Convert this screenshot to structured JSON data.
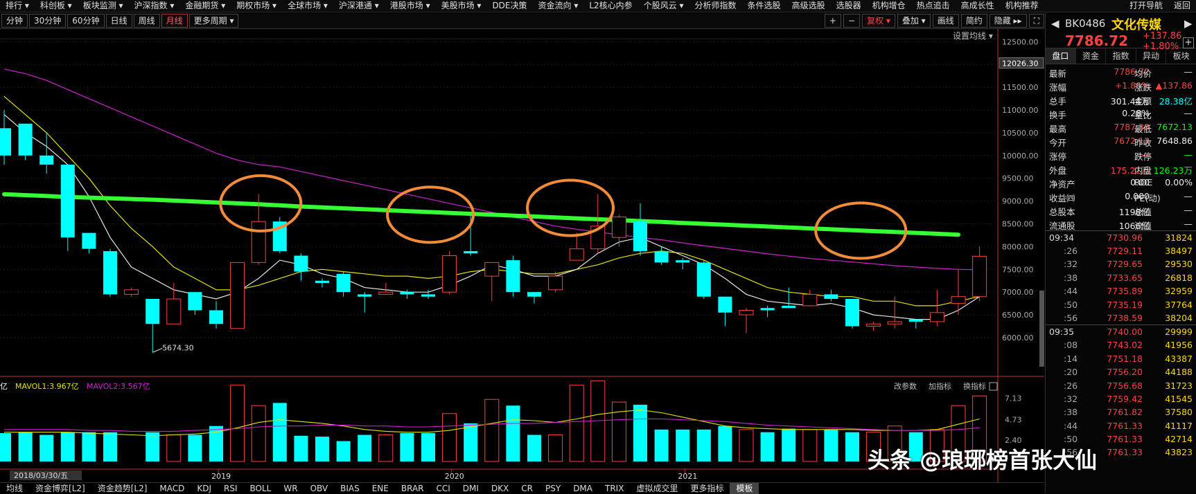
{
  "menubar": {
    "items": [
      "排行 ▾",
      "科创板 ▾",
      "板块监测 ▾",
      "沪深指数 ▾",
      "金融期货 ▾",
      "期权市场 ▾",
      "全球市场 ▾",
      "沪深港通 ▾",
      "港股市场 ▾",
      "美股市场 ▾",
      "DDE决策",
      "资金流向 ▾",
      "L2核心内参",
      "个股风云 ▾",
      "分析师指数",
      "条件选股",
      "高级选股",
      "选股器",
      "机构增仓",
      "热点追击",
      "高成长性",
      "机构推荐"
    ],
    "right": [
      "打开导航",
      "返回"
    ]
  },
  "toolbar": {
    "periods": [
      "分钟",
      "30分钟",
      "60分钟",
      "日线",
      "周线",
      "月线",
      "更多周期 ▾"
    ],
    "active": "月线",
    "right": [
      "+",
      "−",
      "复权 ▾",
      "叠加 ▾",
      "画线",
      "简约",
      "隐藏 ▸▸",
      "⛶"
    ]
  },
  "setting_label": "设置均线 ▾",
  "bottom_tabs": [
    "均线",
    "资金博弈[L2]",
    "资金趋势[L2]",
    "MACD",
    "KDJ",
    "RSI",
    "BOLL",
    "WR",
    "OBV",
    "BIAS",
    "ENE",
    "BRAR",
    "CCI",
    "DMI",
    "DKX",
    "CR",
    "PSY",
    "DMA",
    "TRIX",
    "虚拟成交里",
    "更多指标",
    "模板"
  ],
  "active_bottom": "模板",
  "volume_header": {
    "mavol1": "MAVOL1:3.967亿",
    "mavol2": "MAVOL2:3.567亿",
    "prefix": "亿"
  },
  "volume_tools": [
    "改参数",
    "加指标",
    "换指标"
  ],
  "date_label": "2018/03/30/五",
  "watermark": "头条 @琅琊榜首张大仙",
  "colors": {
    "up": "#ff4040",
    "down": "#00ffff",
    "ma_white": "#e8e8e8",
    "ma_yellow": "#e5e500",
    "ma_magenta": "#d020d0",
    "ma_green": "#33ff33",
    "circle": "#f08c3a"
  },
  "chart_data": {
    "type": "candlestick",
    "price_axis": [
      6000,
      6500,
      7000,
      7500,
      8000,
      8500,
      9000,
      9500,
      10000,
      10500,
      11000,
      11500,
      12000,
      12500
    ],
    "price_axis_labels": [
      "6000.00",
      "6500.00",
      "7000.00",
      "7500.00",
      "8000.00",
      "8500.00",
      "9000.00",
      "9500.00",
      "10000.00",
      "10500.00",
      "11000.00",
      "11500.00",
      "12000.00",
      "12500.00"
    ],
    "price_cursor": "12026.30",
    "low_label": "5674.30",
    "volume_axis": [
      "2.40",
      "4.73",
      "7.13"
    ],
    "x_labels": [
      "2019",
      "2020",
      "2021"
    ],
    "candles": [
      [
        10600,
        10000,
        11000,
        9800,
        3.2
      ],
      [
        10700,
        10000,
        10700,
        9900,
        3.3
      ],
      [
        10000,
        9800,
        10500,
        9600,
        3.0
      ],
      [
        9800,
        8200,
        9800,
        7900,
        3.3
      ],
      [
        8300,
        7950,
        8300,
        7850,
        3.3
      ],
      [
        7900,
        6950,
        7950,
        6900,
        3.3
      ],
      [
        6950,
        7050,
        7100,
        6900,
        0
      ],
      [
        6850,
        6300,
        6850,
        5674.3,
        3.3
      ],
      [
        6300,
        6850,
        7200,
        6300,
        3.0
      ],
      [
        7000,
        6600,
        7000,
        6500,
        3.0
      ],
      [
        6600,
        6300,
        6800,
        6200,
        4.0
      ],
      [
        6200,
        7650,
        7650,
        6200,
        8.6
      ],
      [
        7650,
        8550,
        9150,
        7600,
        6.3
      ],
      [
        8550,
        7900,
        8650,
        7850,
        6.6
      ],
      [
        7800,
        7450,
        7850,
        7250,
        2.9
      ],
      [
        7250,
        7200,
        7300,
        7100,
        2.8
      ],
      [
        7400,
        7000,
        7450,
        6900,
        2.3
      ],
      [
        6950,
        6900,
        7000,
        6550,
        3.0
      ],
      [
        6950,
        7000,
        7200,
        6950,
        3.0
      ],
      [
        7000,
        6950,
        7050,
        6850,
        3.2
      ],
      [
        6950,
        6900,
        7050,
        6850,
        3.2
      ],
      [
        7000,
        7800,
        7900,
        6950,
        5.4
      ],
      [
        7900,
        7850,
        8700,
        7800,
        4.3
      ],
      [
        7350,
        7650,
        7500,
        6800,
        7.0
      ],
      [
        7700,
        7000,
        7800,
        6900,
        6.3
      ],
      [
        7000,
        6900,
        7000,
        6750,
        3.0
      ],
      [
        7050,
        7350,
        7450,
        7000,
        3.0
      ],
      [
        7700,
        7950,
        8300,
        7700,
        8.6
      ],
      [
        7950,
        8450,
        9150,
        7850,
        9.1
      ],
      [
        8200,
        8650,
        8700,
        8000,
        6.7
      ],
      [
        8550,
        7900,
        8950,
        7800,
        6.4
      ],
      [
        7900,
        7650,
        8000,
        7600,
        3.6
      ],
      [
        7700,
        7650,
        7750,
        7500,
        3.6
      ],
      [
        7650,
        6900,
        7700,
        6850,
        3.6
      ],
      [
        6900,
        6550,
        6900,
        6250,
        4.0
      ],
      [
        6500,
        6600,
        6650,
        6100,
        3.6
      ],
      [
        6650,
        6600,
        6700,
        6450,
        3.3
      ],
      [
        6700,
        6650,
        7100,
        6650,
        3.7
      ],
      [
        6700,
        6950,
        7050,
        6700,
        3.6
      ],
      [
        6950,
        6850,
        7050,
        6800,
        3.6
      ],
      [
        6850,
        6250,
        6850,
        6200,
        3.3
      ],
      [
        6250,
        6300,
        6350,
        6150,
        3.3
      ],
      [
        6300,
        6350,
        6900,
        6200,
        4.0
      ],
      [
        6400,
        6350,
        6400,
        6200,
        3.3
      ],
      [
        6350,
        6550,
        7050,
        6250,
        3.6
      ],
      [
        6750,
        6900,
        7500,
        6500,
        6.3
      ],
      [
        6900,
        7787,
        8000,
        6800,
        7.4
      ]
    ],
    "ma_green": [
      9150,
      9130,
      9110,
      9090,
      9075,
      9060,
      9045,
      9030,
      9010,
      8990,
      8970,
      8950,
      8930,
      8905,
      8880,
      8860,
      8840,
      8820,
      8800,
      8780,
      8760,
      8740,
      8720,
      8700,
      8680,
      8660,
      8640,
      8620,
      8600,
      8580,
      8560,
      8540,
      8520,
      8500,
      8480,
      8460,
      8440,
      8420,
      8400,
      8380,
      8360,
      8340,
      8320,
      8300,
      8280,
      8260,
      8240
    ],
    "ma_magenta": [
      11900,
      11800,
      11650,
      11450,
      11250,
      11050,
      10850,
      10650,
      10450,
      10250,
      10050,
      9900,
      9800,
      9750,
      9650,
      9550,
      9450,
      9350,
      9250,
      9150,
      9050,
      8950,
      8850,
      8750,
      8650,
      8550,
      8450,
      8380,
      8320,
      8260,
      8200,
      8150,
      8080,
      8020,
      7960,
      7900,
      7840,
      7790,
      7740,
      7700,
      7660,
      7620,
      7580,
      7550,
      7520,
      7500,
      7490
    ],
    "ma_yellow": [
      11300,
      10900,
      10500,
      10000,
      9500,
      8900,
      8400,
      8000,
      7550,
      7300,
      7050,
      7050,
      7150,
      7300,
      7450,
      7500,
      7450,
      7400,
      7350,
      7350,
      7300,
      7350,
      7450,
      7500,
      7450,
      7400,
      7400,
      7500,
      7600,
      7750,
      7850,
      7900,
      7850,
      7700,
      7500,
      7300,
      7100,
      7000,
      6950,
      6900,
      6900,
      6800,
      6800,
      6700,
      6700,
      6800,
      6900
    ],
    "ma_white": [
      10900,
      10500,
      10200,
      9800,
      9100,
      8200,
      7550,
      7300,
      7050,
      6950,
      6850,
      7000,
      7300,
      7700,
      7600,
      7400,
      7300,
      7100,
      7050,
      7000,
      7000,
      7150,
      7350,
      7600,
      7500,
      7350,
      7350,
      7500,
      7850,
      8100,
      8200,
      8000,
      7800,
      7600,
      7300,
      6950,
      6800,
      6750,
      6700,
      6750,
      6650,
      6500,
      6450,
      6400,
      6400,
      6600,
      6900
    ],
    "vol_ma_yellow": [
      3.3,
      3.3,
      3.3,
      3.3,
      3.2,
      3.1,
      3.0,
      2.9,
      3.0,
      3.1,
      3.3,
      3.8,
      4.4,
      4.7,
      4.5,
      4.3,
      4.0,
      3.6,
      3.4,
      3.3,
      3.3,
      3.5,
      3.9,
      4.3,
      4.7,
      4.6,
      4.4,
      4.8,
      5.3,
      5.6,
      5.8,
      5.5,
      5.0,
      4.5,
      4.0,
      3.8,
      3.7,
      3.6,
      3.6,
      3.6,
      3.6,
      3.5,
      3.5,
      3.5,
      3.6,
      4.2,
      4.8
    ],
    "vol_ma_magenta": [
      3.6,
      3.6,
      3.6,
      3.6,
      3.5,
      3.5,
      3.4,
      3.4,
      3.4,
      3.5,
      3.6,
      3.7,
      3.9,
      4.0,
      4.0,
      4.1,
      4.1,
      4.0,
      4.0,
      3.9,
      3.9,
      4.0,
      4.1,
      4.2,
      4.3,
      4.3,
      4.4,
      4.5,
      4.6,
      4.7,
      4.8,
      4.8,
      4.7,
      4.6,
      4.5,
      4.3,
      4.1,
      4.0,
      3.9,
      3.8,
      3.7,
      3.6,
      3.5,
      3.5,
      3.5,
      3.6,
      3.8
    ]
  },
  "quote": {
    "code": "BK0486",
    "name": "文化传媒",
    "price": "7786.72",
    "change": "+137.86",
    "pct": "+1.80%",
    "tabs": [
      "盘口",
      "资金",
      "指数",
      "异动",
      "板块"
    ],
    "active_tab": "盘口",
    "rows": [
      [
        "最新",
        "7786.72",
        "均价",
        "—"
      ],
      [
        "涨幅",
        "+1.80%",
        "涨跌",
        "▲137.86"
      ],
      [
        "总手",
        "301.44万",
        "金额",
        "28.38亿"
      ],
      [
        "换手",
        "0.28%",
        "量比",
        "—"
      ],
      [
        "最高",
        "7787.38",
        "最低",
        "7672.13"
      ],
      [
        "今开",
        "7672.13",
        "昨收",
        "7648.86"
      ],
      [
        "涨停",
        "—",
        "跌停",
        "—"
      ],
      [
        "外盘",
        "175.21万",
        "内盘",
        "126.23万"
      ],
      [
        "净资产",
        "0.00",
        "ROE",
        "0.00%"
      ],
      [
        "收益㈣",
        "0.000",
        "PE(动)",
        "—"
      ],
      [
        "总股本",
        "1198亿",
        "总值",
        "—"
      ],
      [
        "流通股",
        "1066亿",
        "流值",
        "—"
      ]
    ],
    "row_colors": [
      [
        "#ddd",
        "#ff4040",
        "#ddd",
        "#ddd"
      ],
      [
        "#ddd",
        "#ff4040",
        "#ddd",
        "#ff4040"
      ],
      [
        "#ddd",
        "#eee",
        "#ddd",
        "#00ffff"
      ],
      [
        "#ddd",
        "#eee",
        "#ddd",
        "#ddd"
      ],
      [
        "#ddd",
        "#ff4040",
        "#ddd",
        "#00ff00"
      ],
      [
        "#ddd",
        "#ff4040",
        "#ddd",
        "#eee"
      ],
      [
        "#ddd",
        "#ff4040",
        "#ddd",
        "#00ff00"
      ],
      [
        "#ddd",
        "#ff4040",
        "#ddd",
        "#00ff00"
      ],
      [
        "#ddd",
        "#eee",
        "#ddd",
        "#eee"
      ],
      [
        "#ddd",
        "#eee",
        "#ddd",
        "#ddd"
      ],
      [
        "#ddd",
        "#eee",
        "#ddd",
        "#ddd"
      ],
      [
        "#ddd",
        "#eee",
        "#ddd",
        "#ddd"
      ]
    ],
    "ticks_a": {
      "head": [
        "09:34",
        "7730.96",
        "31824"
      ],
      "rows": [
        [
          ":26",
          "7729.11",
          "38497"
        ],
        [
          ":32",
          "7729.65",
          "29530"
        ],
        [
          ":38",
          "7733.65",
          "26818"
        ],
        [
          ":44",
          "7735.89",
          "32959"
        ],
        [
          ":50",
          "7735.19",
          "37764"
        ],
        [
          ":56",
          "7738.59",
          "38204"
        ]
      ]
    },
    "ticks_b": {
      "head": [
        "09:35",
        "7740.00",
        "29999"
      ],
      "rows": [
        [
          ":08",
          "7743.02",
          "41956"
        ],
        [
          ":14",
          "7751.18",
          "43387"
        ],
        [
          ":20",
          "7756.20",
          "44188"
        ],
        [
          ":26",
          "7756.68",
          "31723"
        ],
        [
          ":32",
          "7759.42",
          "41545"
        ],
        [
          ":38",
          "7761.82",
          "37580"
        ],
        [
          ":44",
          "7761.33",
          "41117"
        ],
        [
          ":50",
          "7761.33",
          "42714"
        ],
        [
          ":56",
          "7761.33",
          "43823"
        ]
      ]
    }
  }
}
